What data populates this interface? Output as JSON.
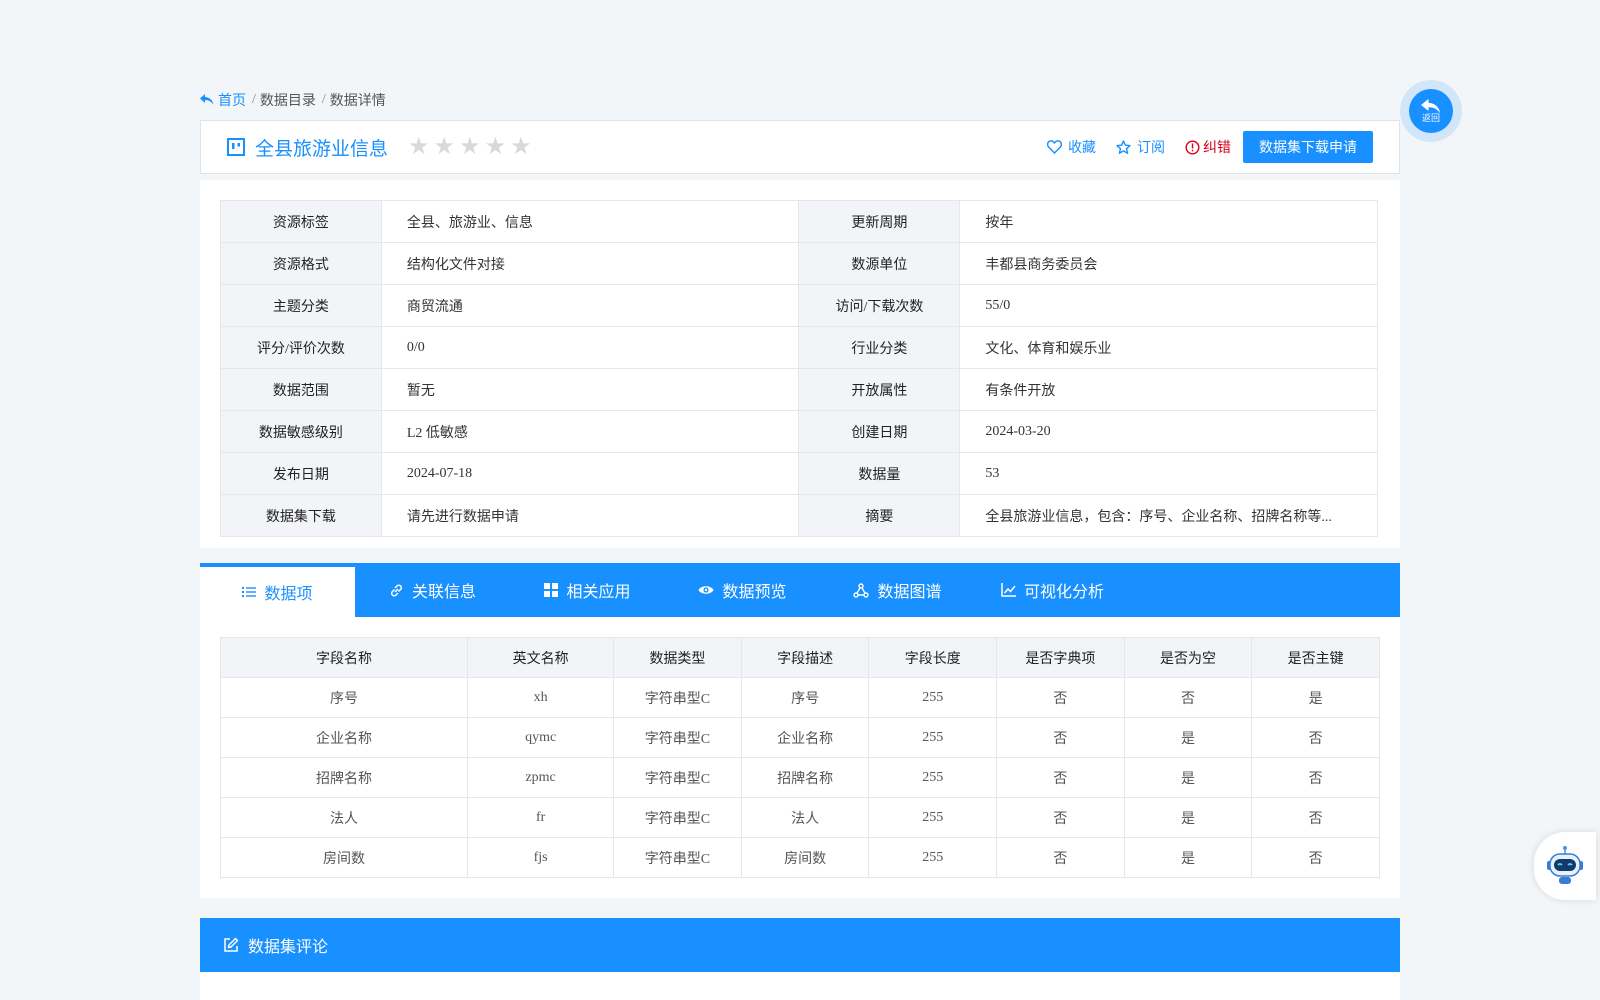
{
  "breadcrumb": {
    "home": "首页",
    "items": [
      "数据目录",
      "数据详情"
    ]
  },
  "dataset": {
    "title": "全县旅游业信息",
    "rating_stars": 0,
    "rating_max": 5
  },
  "actions": {
    "favorite": "收藏",
    "subscribe": "订阅",
    "report": "纠错",
    "apply": "数据集下载申请"
  },
  "info_rows": [
    [
      {
        "k": "资源标签",
        "v": "全县、旅游业、信息"
      },
      {
        "k": "更新周期",
        "v": "按年"
      }
    ],
    [
      {
        "k": "资源格式",
        "v": "结构化文件对接"
      },
      {
        "k": "数源单位",
        "v": "丰都县商务委员会"
      }
    ],
    [
      {
        "k": "主题分类",
        "v": "商贸流通"
      },
      {
        "k": "访问/下载次数",
        "v": "55/0"
      }
    ],
    [
      {
        "k": "评分/评价次数",
        "v": "0/0"
      },
      {
        "k": "行业分类",
        "v": "文化、体育和娱乐业"
      }
    ],
    [
      {
        "k": "数据范围",
        "v": "暂无"
      },
      {
        "k": "开放属性",
        "v": "有条件开放"
      }
    ],
    [
      {
        "k": "数据敏感级别",
        "v": "L2 低敏感"
      },
      {
        "k": "创建日期",
        "v": "2024-03-20"
      }
    ],
    [
      {
        "k": "发布日期",
        "v": "2024-07-18"
      },
      {
        "k": "数据量",
        "v": "53"
      }
    ],
    [
      {
        "k": "数据集下载",
        "v": "请先进行数据申请"
      },
      {
        "k": "摘要",
        "v": "全县旅游业信息，包含：序号、企业名称、招牌名称等..."
      }
    ]
  ],
  "tabs": [
    {
      "label": "数据项",
      "icon": "list-icon",
      "active": true
    },
    {
      "label": "关联信息",
      "icon": "link-icon",
      "active": false
    },
    {
      "label": "相关应用",
      "icon": "grid-icon",
      "active": false
    },
    {
      "label": "数据预览",
      "icon": "eye-icon",
      "active": false
    },
    {
      "label": "数据图谱",
      "icon": "graph-icon",
      "active": false
    },
    {
      "label": "可视化分析",
      "icon": "chart-icon",
      "active": false
    }
  ],
  "fields": {
    "headers": [
      "字段名称",
      "英文名称",
      "数据类型",
      "字段描述",
      "字段长度",
      "是否字典项",
      "是否为空",
      "是否主键"
    ],
    "rows": [
      [
        "序号",
        "xh",
        "字符串型C",
        "序号",
        "255",
        "否",
        "否",
        "是"
      ],
      [
        "企业名称",
        "qymc",
        "字符串型C",
        "企业名称",
        "255",
        "否",
        "是",
        "否"
      ],
      [
        "招牌名称",
        "zpmc",
        "字符串型C",
        "招牌名称",
        "255",
        "否",
        "是",
        "否"
      ],
      [
        "法人",
        "fr",
        "字符串型C",
        "法人",
        "255",
        "否",
        "是",
        "否"
      ],
      [
        "房间数",
        "fjs",
        "字符串型C",
        "房间数",
        "255",
        "否",
        "是",
        "否"
      ]
    ]
  },
  "comments": {
    "title": "数据集评论"
  },
  "float": {
    "back_label": "返回"
  },
  "colors": {
    "accent": "#1890ff",
    "error": "#d9001b",
    "star_empty": "#d9d9d9"
  }
}
